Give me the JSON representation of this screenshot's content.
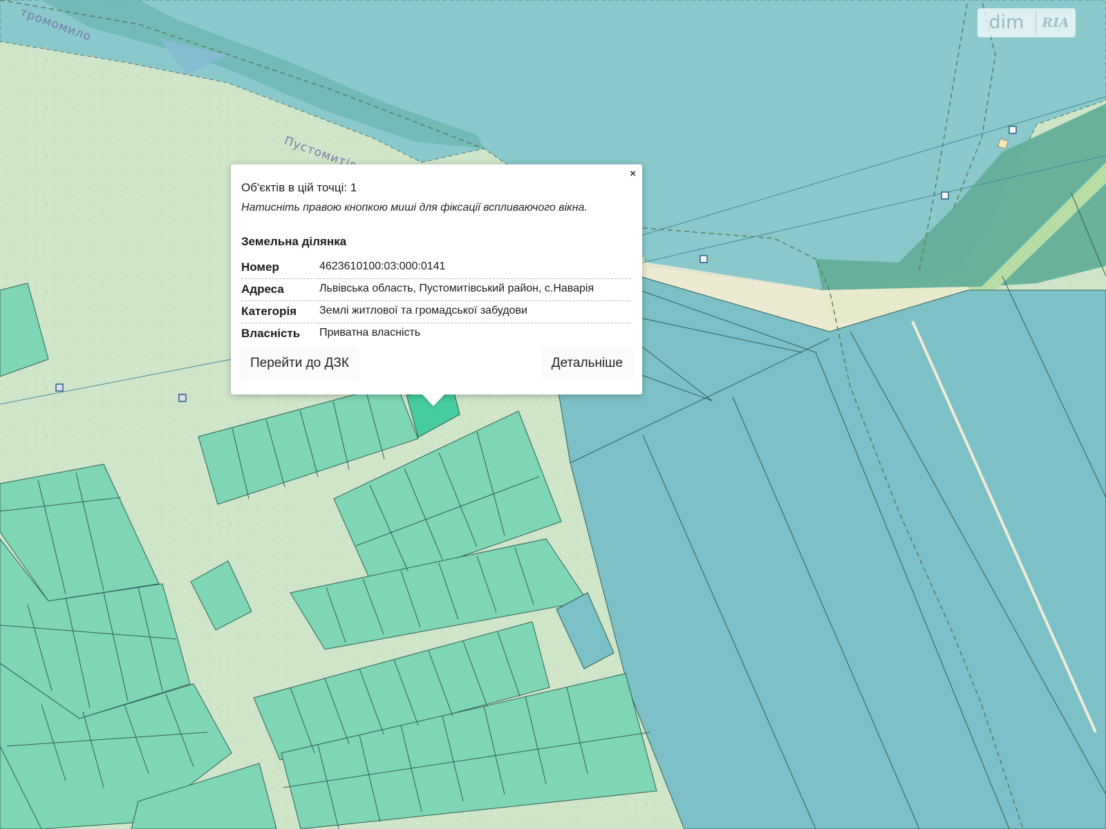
{
  "map": {
    "road_label": "Пустомитів",
    "road_label_top": "тромомило",
    "colors": {
      "background": "#cfe5c8",
      "parcel_residential": "#7ed6b4",
      "parcel_selected": "#46cc9e",
      "parcel_agricultural": "#7cc0c8",
      "parcel_outline": "#2f5e56",
      "boundary_dashed": "#5e7c5c",
      "road_strip": "#f1ecd4"
    }
  },
  "watermark": {
    "left_text": "dim",
    "right_text": "RIA"
  },
  "popup": {
    "close_symbol": "×",
    "objects_count_text": "Об'єктів в цій точці: 1",
    "hint_text": "Натисніть правою кнопкою миші для фіксації вспливаючого вікна.",
    "heading": "Земельна ділянка",
    "attributes": [
      {
        "key": "Номер",
        "value": "4623610100:03:000:0141"
      },
      {
        "key": "Адреса",
        "value": "Львівська область, Пустомитівський район, с.Наварія"
      },
      {
        "key": "Категорія",
        "value": "Землі житлової та громадської забудови"
      },
      {
        "key": "Власність",
        "value": "Приватна власність"
      }
    ],
    "goto_button": "Перейти до ДЗК",
    "details_button": "Детальніше"
  }
}
